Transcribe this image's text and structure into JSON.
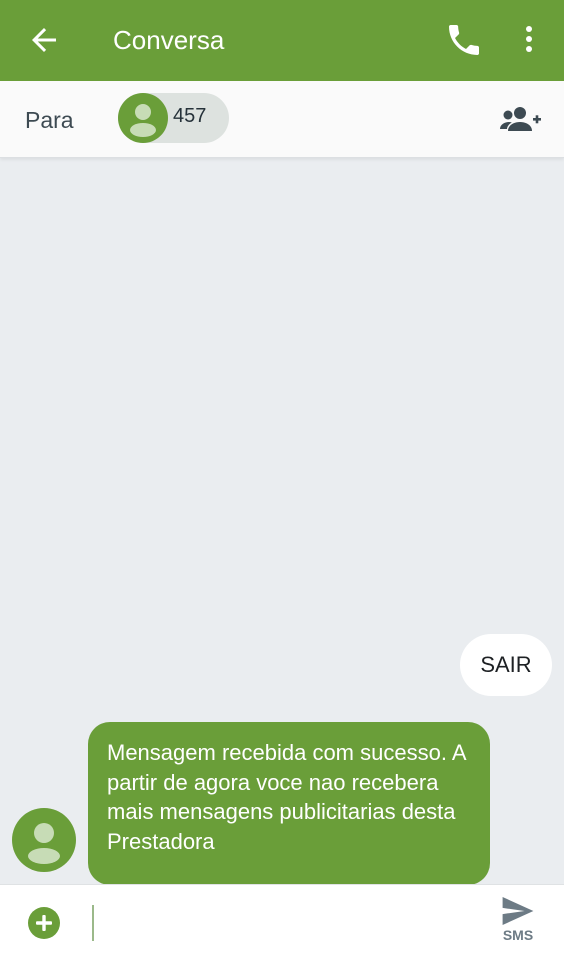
{
  "appbar": {
    "title": "Conversa",
    "icons": [
      "arrow-back-icon",
      "phone-icon",
      "more-vert-icon"
    ]
  },
  "recipients": {
    "label": "Para",
    "chip_number": "457",
    "icons": [
      "contact-avatar-icon",
      "add-person-icon"
    ]
  },
  "messages": [
    {
      "direction": "outgoing",
      "text": "SAIR"
    },
    {
      "direction": "incoming",
      "text": "Mensagem recebida com sucesso. A partir de agora voce nao recebera mais mensagens publicitarias desta Prestadora"
    }
  ],
  "composer": {
    "placeholder": "",
    "send_label": "SMS",
    "icons": [
      "attach-plus-icon",
      "send-icon"
    ]
  },
  "colors": {
    "accent": "#6a9e39",
    "background": "#eaedf0",
    "chip": "#dde2df"
  }
}
